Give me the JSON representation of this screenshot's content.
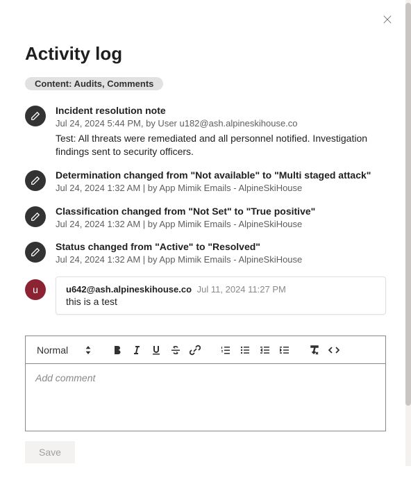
{
  "title": "Activity log",
  "content_pill": "Content: Audits, Comments",
  "entries": [
    {
      "title": "Incident resolution note",
      "meta": "Jul 24, 2024 5:44 PM, by User u182@ash.alpineskihouse.co",
      "body": "Test: All threats were remediated and all personnel notified. Investigation findings sent to security officers."
    },
    {
      "title": "Determination changed from \"Not available\" to \"Multi staged attack\"",
      "meta": "Jul 24, 2024 1:32 AM | by App Mimik Emails - AlpineSkiHouse"
    },
    {
      "title": "Classification changed from \"Not Set\" to \"True positive\"",
      "meta": "Jul 24, 2024 1:32 AM | by App Mimik Emails - AlpineSkiHouse"
    },
    {
      "title": "Status changed from \"Active\" to \"Resolved\"",
      "meta": "Jul 24, 2024 1:32 AM | by App Mimik Emails - AlpineSkiHouse"
    }
  ],
  "comment": {
    "avatar_initial": "u",
    "user": "u642@ash.alpineskihouse.co",
    "timestamp": "Jul 11, 2024 11:27 PM",
    "text": "this is a test"
  },
  "editor": {
    "format_label": "Normal",
    "placeholder": "Add comment"
  },
  "actions": {
    "save_label": "Save"
  }
}
